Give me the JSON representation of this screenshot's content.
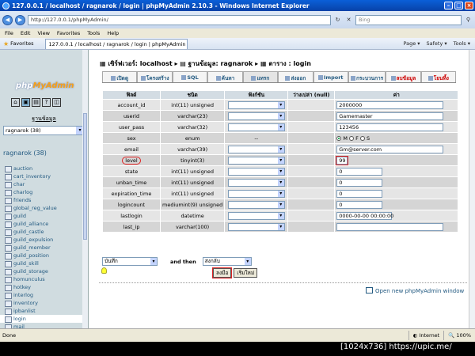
{
  "window": {
    "title": "127.0.0.1 / localhost / ragnarok / login | phpMyAdmin 2.10.3 - Windows Internet Explorer",
    "address": "http://127.0.0.1/phpMyAdmin/",
    "search_placeholder": "Bing",
    "menu": [
      "File",
      "Edit",
      "View",
      "Favorites",
      "Tools",
      "Help"
    ],
    "favorites_label": "Favorites",
    "tab_label": "127.0.0.1 / localhost / ragnarok / login | phpMyAdmin ...",
    "fav_tools": [
      "Page ▾",
      "Safety ▾",
      "Tools ▾"
    ]
  },
  "sidebar": {
    "logo_main": "php",
    "logo_accent": "MyAdmin",
    "db_label": "ฐานข้อมูล",
    "db_select": "ragnarok (38)",
    "db_heading": "ragnarok (38)",
    "tables": [
      "auction",
      "cart_inventory",
      "char",
      "charlog",
      "friends",
      "global_reg_value",
      "guild",
      "guild_alliance",
      "guild_castle",
      "guild_expulsion",
      "guild_member",
      "guild_position",
      "guild_skill",
      "guild_storage",
      "homunculus",
      "hotkey",
      "interlog",
      "inventory",
      "ipbanlist",
      "login",
      "mail"
    ]
  },
  "breadcrumb": {
    "server": "เซิร์ฟเวอร์: localhost",
    "database": "ฐานข้อมูล: ragnarok",
    "table": "ตาราง : login"
  },
  "tabs": [
    "เปิดดู",
    "โครงสร้าง",
    "SQL",
    "ค้นหา",
    "แทรก",
    "ส่งออก",
    "Import",
    "กระบวนการ",
    "ลบข้อมูล",
    "โยนทิ้ง"
  ],
  "columns": [
    "ฟิลด์",
    "ชนิด",
    "ฟังก์ชัน",
    "ว่างเปล่า (null)",
    "ค่า"
  ],
  "rows": [
    {
      "field": "account_id",
      "type": "int(11) unsigned",
      "value": "2000000"
    },
    {
      "field": "userid",
      "type": "varchar(23)",
      "value": "Gamemaster"
    },
    {
      "field": "user_pass",
      "type": "varchar(32)",
      "value": "123456"
    },
    {
      "field": "sex",
      "type": "enum",
      "func": "--",
      "value": ""
    },
    {
      "field": "email",
      "type": "varchar(39)",
      "value": "Gm@server.com"
    },
    {
      "field": "level",
      "type": "tinyint(3)",
      "value": "99"
    },
    {
      "field": "state",
      "type": "int(11) unsigned",
      "value": "0"
    },
    {
      "field": "unban_time",
      "type": "int(11) unsigned",
      "value": "0"
    },
    {
      "field": "expiration_time",
      "type": "int(11) unsigned",
      "value": "0"
    },
    {
      "field": "logincount",
      "type": "mediumint(9) unsigned",
      "value": "0"
    },
    {
      "field": "lastlogin",
      "type": "datetime",
      "value": "0000-00-00 00:00:00"
    },
    {
      "field": "last_ip",
      "type": "varchar(100)",
      "value": ""
    }
  ],
  "sex_options": [
    "M",
    "F",
    "S"
  ],
  "bottom": {
    "action_select": "บันทึก",
    "and_then": "and then",
    "after_select": "ส่งกลับ",
    "go_button": "ลงมือ",
    "reset_button": "เริ่มใหม่"
  },
  "new_window_link": "Open new phpMyAdmin window",
  "status": {
    "left": "Done",
    "zone": "Internet",
    "zoom": "100%"
  },
  "watermark": "[1024x736] https://upic.me/"
}
